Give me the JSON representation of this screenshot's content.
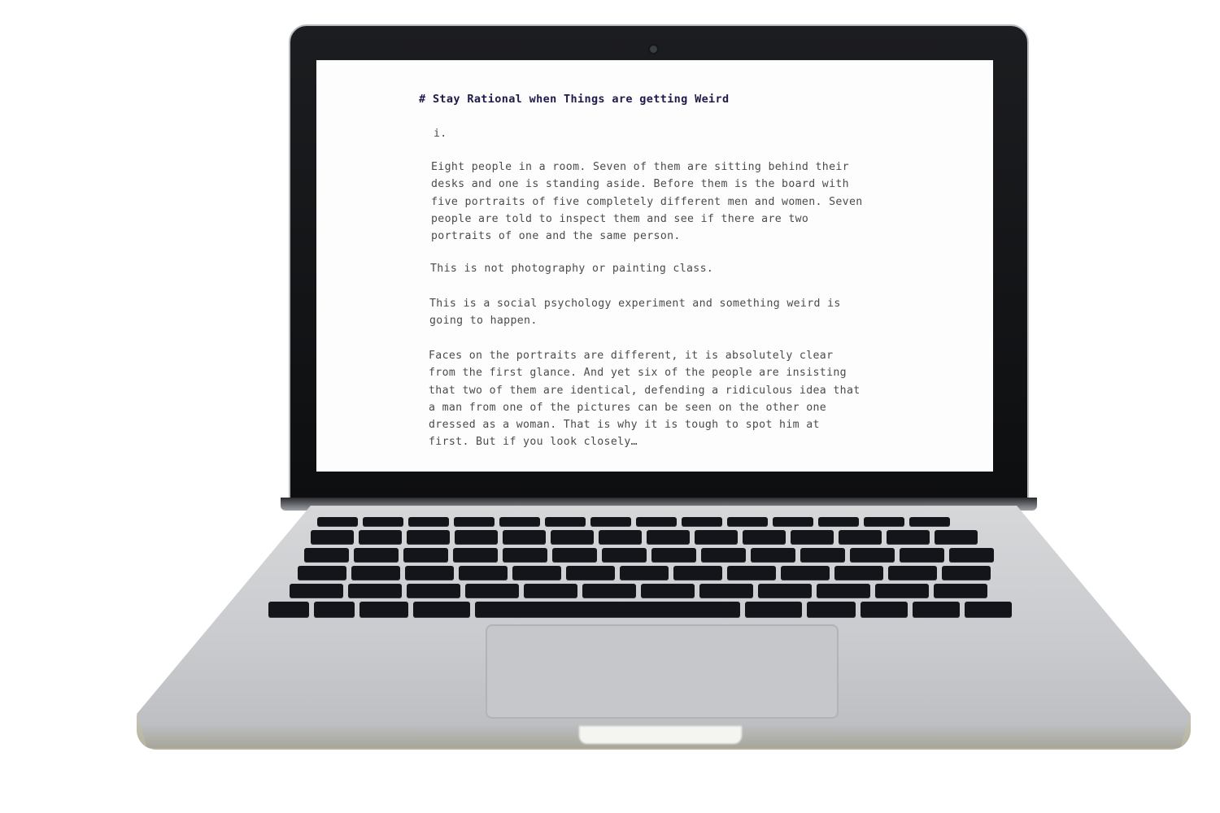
{
  "document": {
    "title": "# Stay Rational when Things are getting Weird",
    "section": "i.",
    "paragraphs": [
      "Eight people in a room. Seven of them are sitting behind their\ndesks and one is standing aside. Before them is the board with\nfive portraits of five completely different men and women. Seven\npeople are told to inspect them and see if there are two\nportraits of one and the same person.",
      "This is not photography or painting class.",
      "This is a social psychology experiment and something weird is\ngoing to happen.",
      "Faces on the portraits are different, it is absolutely clear\nfrom the first glance. And yet six of the people are insisting\nthat two of them are identical, defending a ridiculous idea that\na man from one of the pictures can be seen on the other one\ndressed as a woman. That is why it is tough to spot him at\nfirst. But if you look closely…"
    ]
  },
  "colors": {
    "title_text": "#1e1a4a",
    "body_text": "#4a4a4f",
    "screen_bg": "#fdfdfd",
    "aluminium": "#c9cbce",
    "keys": "#14151a"
  }
}
